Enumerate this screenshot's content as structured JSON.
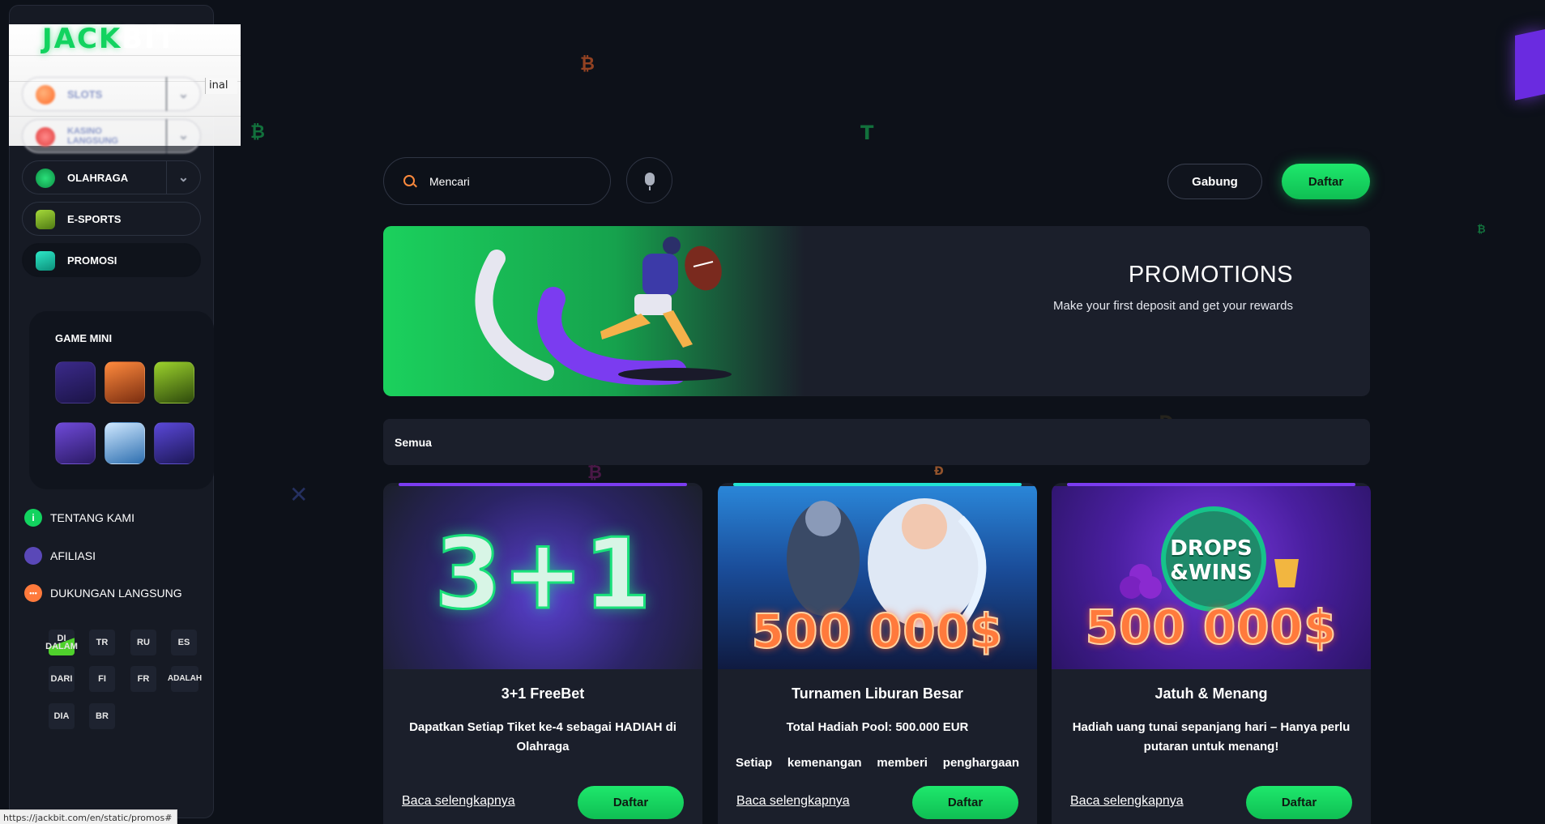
{
  "brand": {
    "logo_jack": "JACK",
    "logo_bit": "BIT"
  },
  "ghost_overlay": {
    "partial_text": "inal"
  },
  "sidebar": {
    "nav": [
      {
        "label": "SLOTS",
        "icon": "fire-ball-icon"
      },
      {
        "label": "KASINO LANGSUNG",
        "icon": "poker-chip-icon"
      },
      {
        "label": "OLAHRAGA",
        "icon": "basketball-icon"
      },
      {
        "label": "E-SPORTS",
        "icon": "gamepad-icon"
      },
      {
        "label": "PROMOSI",
        "icon": "bookmark-icon"
      }
    ],
    "mini_games_title": "GAME MINI",
    "links": [
      {
        "label": "TENTANG KAMI",
        "icon": "info-icon"
      },
      {
        "label": "AFILIASI",
        "icon": "users-icon"
      },
      {
        "label": "DUKUNGAN LANGSUNG",
        "icon": "chat-icon"
      }
    ],
    "languages": [
      "DI DALAM",
      "TR",
      "RU",
      "ES",
      "DARI",
      "FI",
      "FR",
      "ADALAH",
      "DIA",
      "BR"
    ]
  },
  "topbar": {
    "search_placeholder": "Mencari",
    "login_label": "Gabung",
    "register_label": "Daftar"
  },
  "banner": {
    "title": "PROMOTIONS",
    "subtitle": "Make your first deposit and get your rewards"
  },
  "filter": {
    "label": "Semua"
  },
  "cards": [
    {
      "title": "3+1 FreeBet",
      "description": "Dapatkan Setiap Tiket ke-4 sebagai HADIAH di Olahraga",
      "extra": "",
      "art_text": "3+1",
      "read_more": "Baca selengkapnya",
      "button": "Daftar",
      "accent": "#7b3cf0"
    },
    {
      "title": "Turnamen Liburan Besar",
      "description": "Total Hadiah Pool: 500.000 EUR",
      "extra": "Setiap kemenangan memberi penghargaan",
      "art_text": "500 000$",
      "read_more": "Baca selengkapnya",
      "button": "Daftar",
      "accent": "#22e3d3"
    },
    {
      "title": "Jatuh & Menang",
      "description": "Hadiah uang tunai sepanjang hari – Hanya perlu putaran untuk menang!",
      "extra": "",
      "art_text": "500 000$",
      "art_badge_line1": "DROPS",
      "art_badge_line2": "&WINS",
      "read_more": "Baca selengkapnya",
      "button": "Daftar",
      "accent": "#7b3cf0"
    }
  ],
  "status_bar": {
    "url": "https://jackbit.com/en/static/promos#"
  },
  "colors": {
    "accent_green": "#12d35f",
    "background": "#0d1119",
    "panel": "#1b1f2b"
  }
}
